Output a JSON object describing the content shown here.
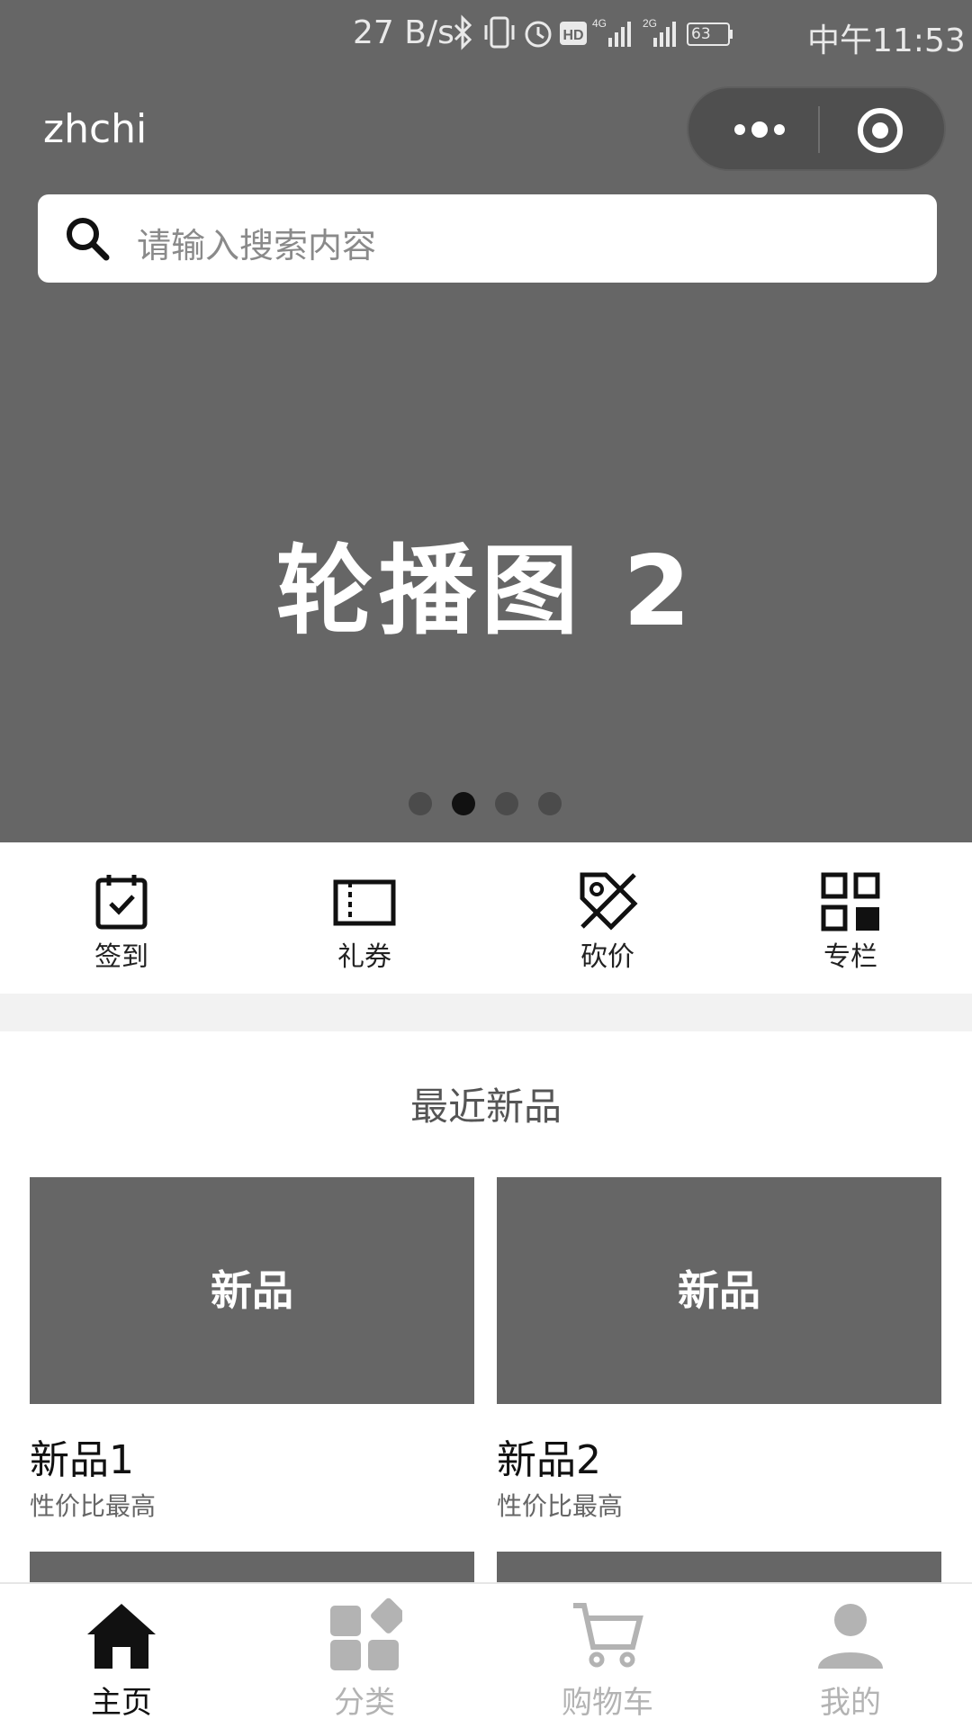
{
  "status_bar": {
    "net_speed": "27 B/s",
    "battery": "63",
    "time": "中午11:53",
    "icons": [
      "bluetooth-icon",
      "vibrate-icon",
      "alarm-icon",
      "hd-icon",
      "signal-4g-icon",
      "signal-2g-icon",
      "battery-icon"
    ]
  },
  "header": {
    "title": "zhchi",
    "capsule_icons": [
      "more-dots-icon",
      "close-target-icon"
    ]
  },
  "search": {
    "placeholder": "请输入搜索内容"
  },
  "carousel": {
    "slide_title": "轮播图 2",
    "dot_count": 4,
    "active_index": 1
  },
  "quick_menu": [
    {
      "label": "签到",
      "icon": "calendar-check-icon"
    },
    {
      "label": "礼券",
      "icon": "ticket-icon"
    },
    {
      "label": "砍价",
      "icon": "price-tag-off-icon"
    },
    {
      "label": "专栏",
      "icon": "grid-icon"
    }
  ],
  "section": {
    "title": "最近新品"
  },
  "products": [
    {
      "image_label": "新品",
      "name": "新品1",
      "subtitle": "性价比最高"
    },
    {
      "image_label": "新品",
      "name": "新品2",
      "subtitle": "性价比最高"
    }
  ],
  "tab_bar": {
    "active_color": "#111111",
    "inactive_color": "#b3b3b3",
    "tabs": [
      {
        "label": "主页",
        "icon": "home-icon",
        "active": true
      },
      {
        "label": "分类",
        "icon": "category-icon",
        "active": false
      },
      {
        "label": "购物车",
        "icon": "cart-icon",
        "active": false
      },
      {
        "label": "我的",
        "icon": "user-icon",
        "active": false
      }
    ]
  }
}
